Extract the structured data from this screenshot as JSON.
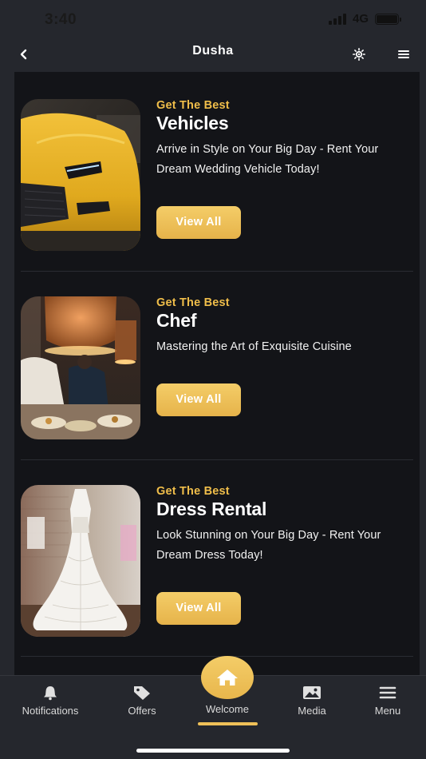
{
  "status_bar": {
    "time": "3:40",
    "network": "4G"
  },
  "nav": {
    "title": "Dusha"
  },
  "cards": [
    {
      "kicker": "Get The Best",
      "heading": "Vehicles",
      "description": "Arrive in Style on Your Big Day - Rent Your Dream Wedding Vehicle Today!",
      "button": "View All"
    },
    {
      "kicker": "Get The Best",
      "heading": "Chef",
      "description": "Mastering the Art of Exquisite Cuisine",
      "button": "View All"
    },
    {
      "kicker": "Get The Best",
      "heading": "Dress Rental",
      "description": "Look Stunning on Your Big Day - Rent Your Dream Dress Today!",
      "button": "View All"
    }
  ],
  "tabs": {
    "notifications": "Notifications",
    "offers": "Offers",
    "welcome": "Welcome",
    "media": "Media",
    "menu": "Menu"
  },
  "active_tab": "Welcome",
  "colors": {
    "accent": "#f0be4a",
    "background": "#131418",
    "bar": "#25272d"
  },
  "icons": [
    "chevron-left-icon",
    "sun-icon",
    "hamburger-menu-icon",
    "bell-icon",
    "tag-icon",
    "home-icon",
    "image-icon",
    "menu-icon"
  ]
}
